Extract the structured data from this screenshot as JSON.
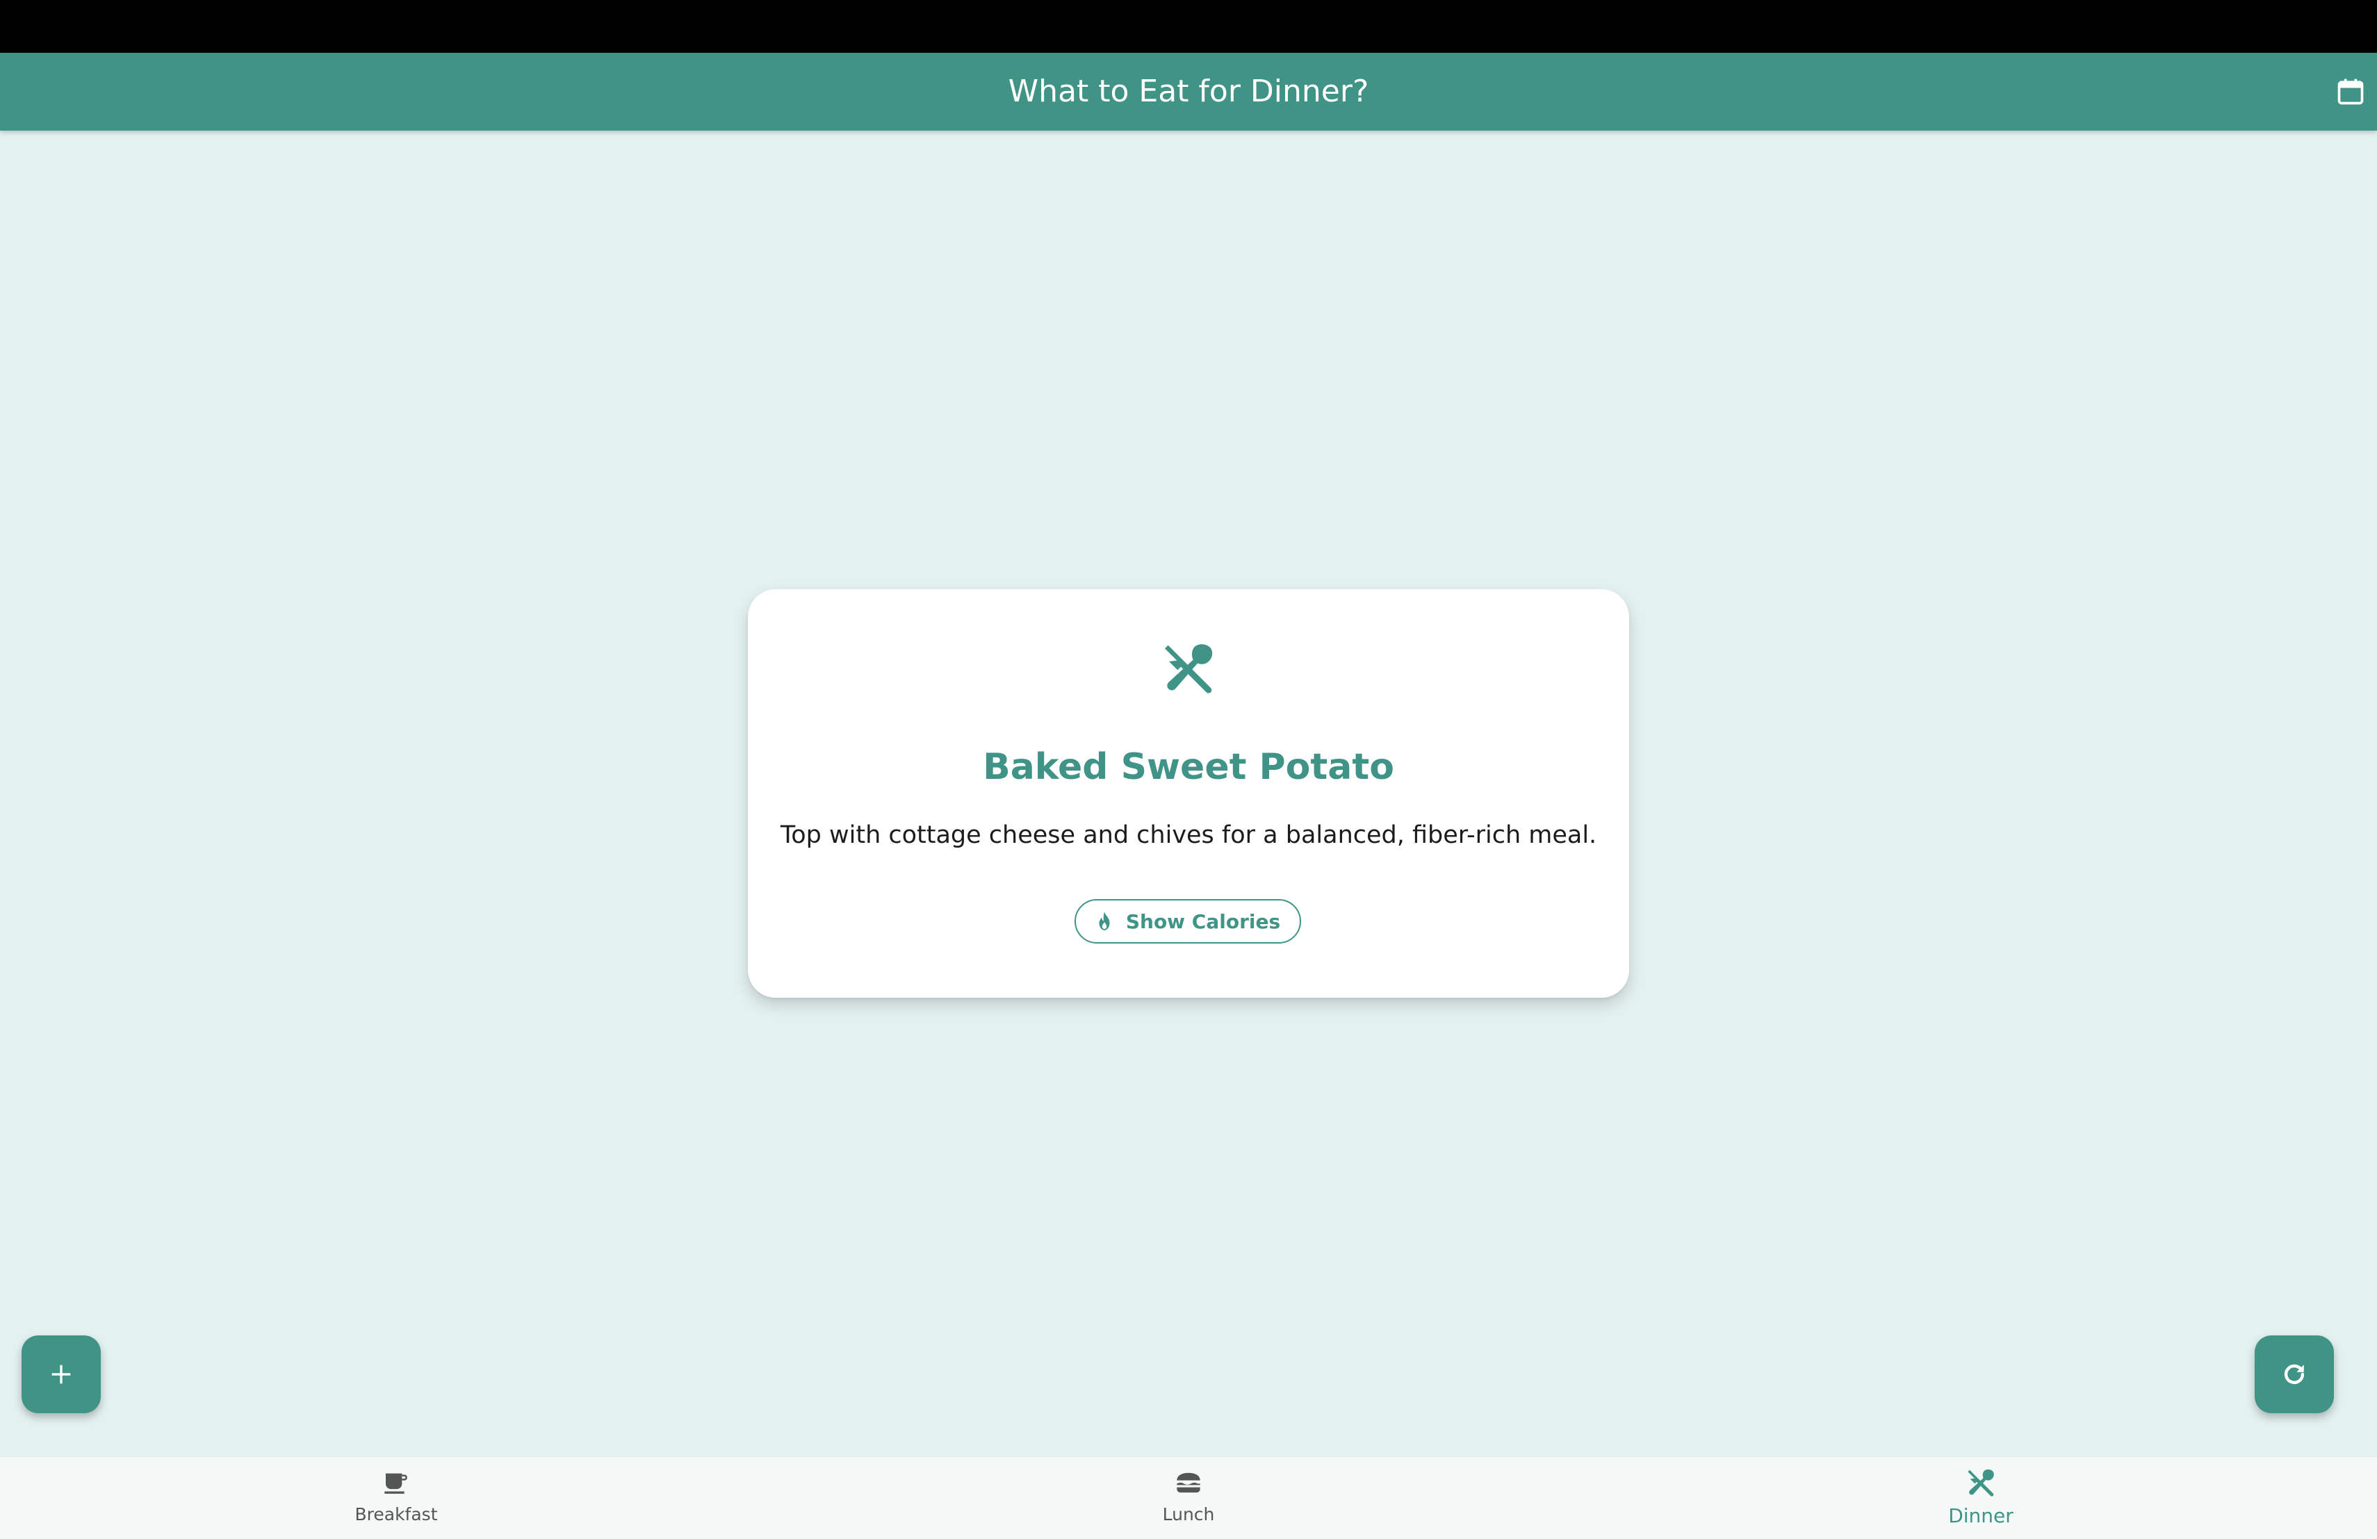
{
  "app_bar": {
    "title": "What to Eat for Dinner?",
    "calendar_icon": "calendar-icon"
  },
  "meal_card": {
    "icon": "utensils-icon",
    "title": "Baked Sweet Potato",
    "description": "Top with cottage cheese and chives for a balanced, fiber-rich meal.",
    "show_calories_label": "Show Calories",
    "show_calories_icon": "flame-icon"
  },
  "fabs": {
    "add_icon": "plus-icon",
    "refresh_icon": "refresh-icon"
  },
  "bottom_nav": {
    "items": [
      {
        "label": "Breakfast",
        "icon": "coffee-icon",
        "active": false
      },
      {
        "label": "Lunch",
        "icon": "burger-icon",
        "active": false
      },
      {
        "label": "Dinner",
        "icon": "utensils-icon",
        "active": true
      }
    ]
  },
  "colors": {
    "primary": "#409486",
    "background": "#e3f1f0",
    "card": "#ffffff",
    "nav_background": "#f4f9f8",
    "inactive": "#555555"
  }
}
